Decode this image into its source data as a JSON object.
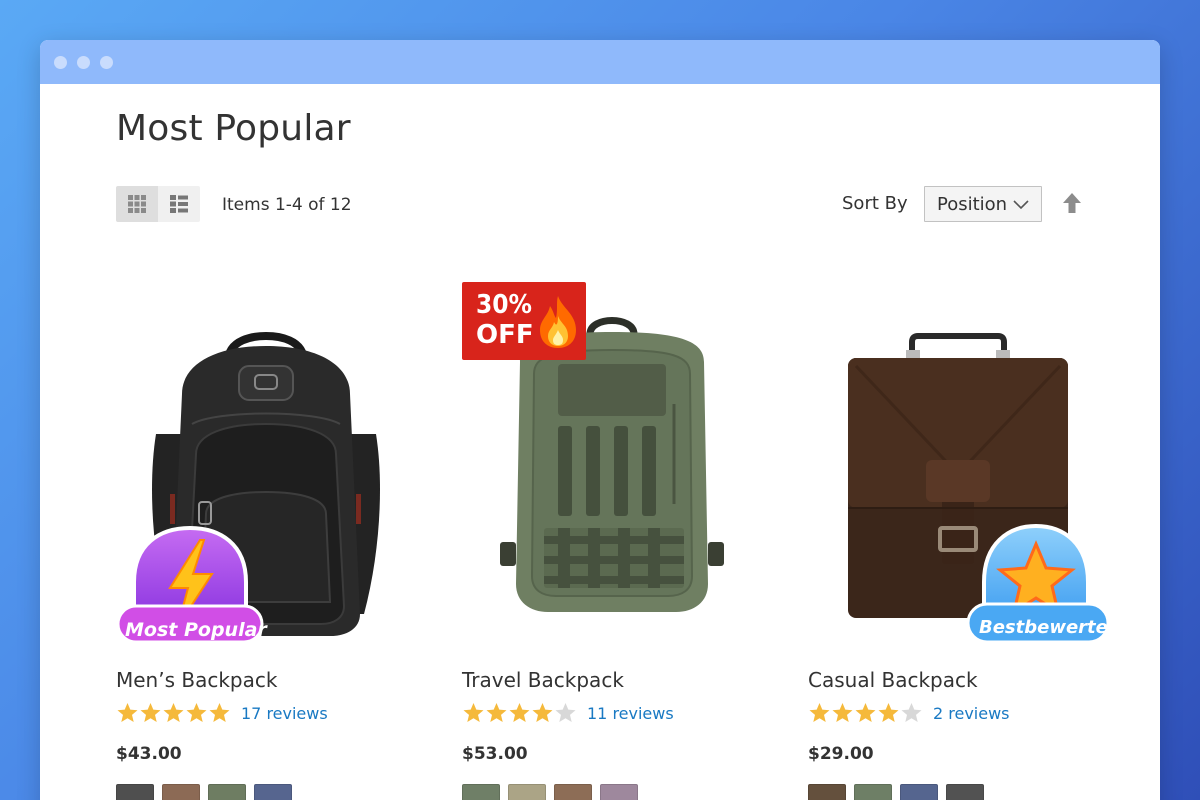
{
  "page": {
    "title": "Most Popular",
    "items_label": "Items 1-4 of 12",
    "sort_label": "Sort By",
    "sort_value": "Position"
  },
  "colors": {
    "background_top": "#5aa9f5",
    "background_bottom": "#2f4fb8",
    "titlebar": "#8fb9fb",
    "link": "#1979c3",
    "star_filled": "#f5b93b",
    "star_empty": "#d8d8d8"
  },
  "products": [
    {
      "name": "Men’s Backpack",
      "rating_stars": 5,
      "reviews": "17 reviews",
      "price": "$43.00",
      "badge": "Most Popular",
      "badge_icon": "lightning-icon",
      "swatches": [
        "#4f4f4f",
        "#8c6a55",
        "#6e7d62",
        "#56658f"
      ]
    },
    {
      "name": "Travel Backpack",
      "rating_stars": 4,
      "reviews": "11 reviews",
      "price": "$53.00",
      "badge_line1": "30%",
      "badge_line2": "OFF",
      "badge_icon": "fire-icon",
      "swatches": [
        "#6f7f67",
        "#aba486",
        "#8d6d56",
        "#9e889d"
      ]
    },
    {
      "name": "Casual Backpack",
      "rating_stars": 4,
      "reviews": "2 reviews",
      "price": "$29.00",
      "badge": "Bestbewertet",
      "badge_icon": "star-badge-icon",
      "swatches": [
        "#64503d",
        "#6e7f66",
        "#55658f",
        "#525252"
      ]
    }
  ]
}
